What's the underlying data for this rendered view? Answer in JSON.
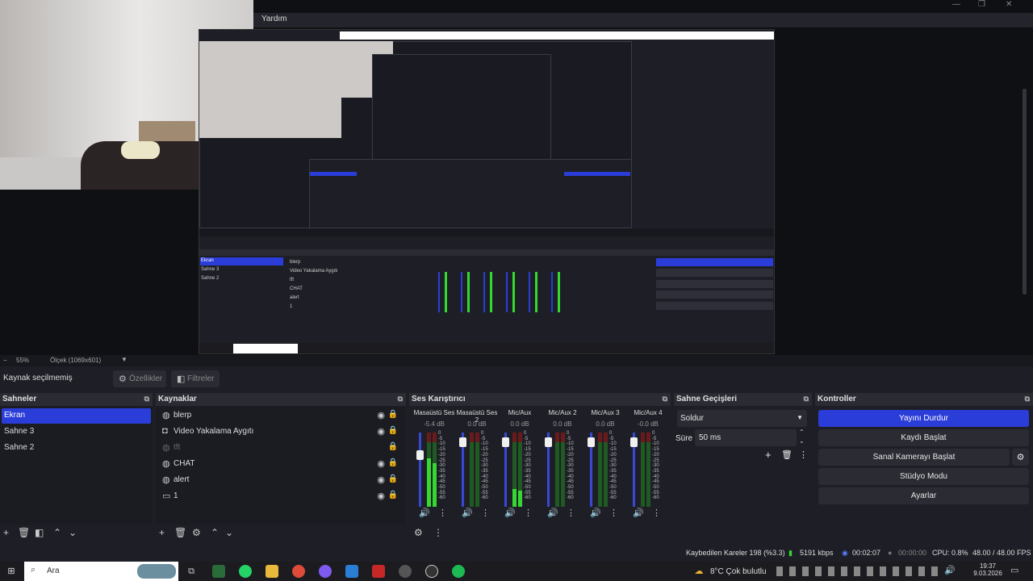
{
  "window": {
    "controls": [
      "—",
      "❐",
      "✕"
    ]
  },
  "nested_title": "Yardım",
  "zoom": {
    "percent": "55%",
    "scale_label": "Ölçek (1069x601)"
  },
  "toolbar": {
    "no_source": "Kaynak seçilmemiş",
    "properties": "Özellikler",
    "filters": "Filtreler"
  },
  "scenes": {
    "title": "Sahneler",
    "items": [
      "Ekran",
      "Sahne 3",
      "Sahne 2"
    ],
    "selected": 0
  },
  "sources": {
    "title": "Kaynaklar",
    "items": [
      {
        "label": "blerp",
        "icon": "globe-icon",
        "visible": true
      },
      {
        "label": "Video Yakalama Aygıtı",
        "icon": "camera-icon",
        "visible": true
      },
      {
        "label": "tft",
        "icon": "globe-icon",
        "visible": false
      },
      {
        "label": "CHAT",
        "icon": "globe-icon",
        "visible": true
      },
      {
        "label": "alert",
        "icon": "globe-icon",
        "visible": true
      },
      {
        "label": "1",
        "icon": "monitor-icon",
        "visible": true
      }
    ]
  },
  "mixer": {
    "title": "Ses Karıştırıcı",
    "channels": [
      {
        "name": "Masaüstü Ses",
        "db": "-5.4 dB",
        "level": 0.75,
        "slider": 0.72
      },
      {
        "name": "Masaüstü Ses 2",
        "db": "0.0 dB",
        "level": 0.0,
        "slider": 0.92
      },
      {
        "name": "Mic/Aux",
        "db": "0.0 dB",
        "level": 0.28,
        "slider": 0.92
      },
      {
        "name": "Mic/Aux 2",
        "db": "0.0 dB",
        "level": 0.0,
        "slider": 0.92
      },
      {
        "name": "Mic/Aux 3",
        "db": "0.0 dB",
        "level": 0.0,
        "slider": 0.92
      },
      {
        "name": "Mic/Aux 4",
        "db": "-0.0 dB",
        "level": 0.0,
        "slider": 0.92
      }
    ],
    "scale": [
      "0",
      "-5",
      "-10",
      "-15",
      "-20",
      "-25",
      "-30",
      "-35",
      "-40",
      "-45",
      "-50",
      "-55",
      "-60"
    ]
  },
  "transitions": {
    "title": "Sahne Geçişleri",
    "selected": "Soldur",
    "duration_label": "Süre",
    "duration": "50 ms"
  },
  "controls": {
    "title": "Kontroller",
    "buttons": [
      "Yayını Durdur",
      "Kaydı Başlat",
      "Sanal Kamerayı Başlat",
      "Stüdyo Modu",
      "Ayarlar"
    ]
  },
  "status": {
    "dropped": "Kaybedilen Kareler 198 (%3.3)",
    "bitrate": "5191 kbps",
    "stream_time": "00:02:07",
    "rec_time": "00:00:00",
    "cpu": "CPU: 0.8%",
    "fps": "48.00 / 48.00 FPS"
  },
  "taskbar": {
    "search": "Ara",
    "weather": "8°C  Çok bulutlu",
    "time": "19:37",
    "date": "9.03.2026"
  }
}
